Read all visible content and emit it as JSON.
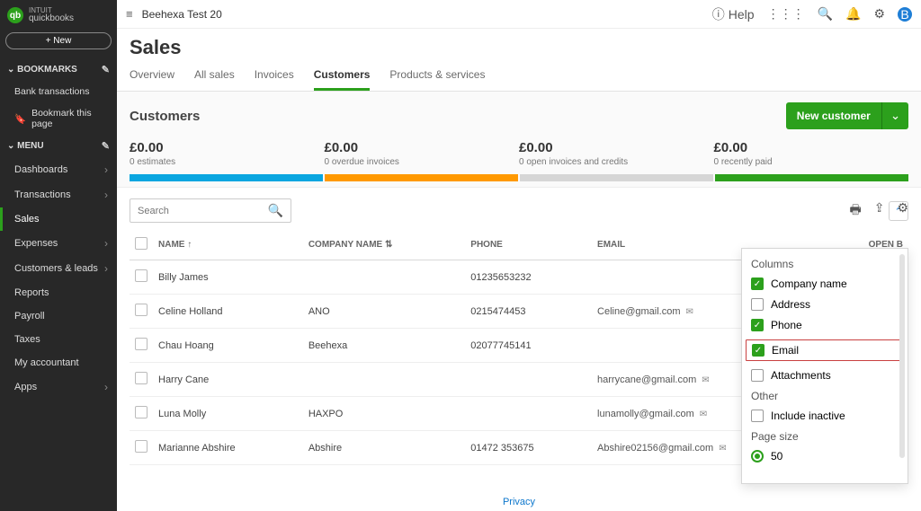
{
  "brand": {
    "short": "qb",
    "name": "quickbooks",
    "sub": "INTUIT"
  },
  "new_btn": "+   New",
  "bookmarks": {
    "title": "BOOKMARKS",
    "items": [
      "Bank transactions",
      "Bookmark this page"
    ]
  },
  "menu": {
    "title": "MENU",
    "items": [
      {
        "label": "Dashboards",
        "arrow": true
      },
      {
        "label": "Transactions",
        "arrow": true
      },
      {
        "label": "Sales",
        "arrow": false,
        "active": true
      },
      {
        "label": "Expenses",
        "arrow": true
      },
      {
        "label": "Customers & leads",
        "arrow": true
      },
      {
        "label": "Reports",
        "arrow": false
      },
      {
        "label": "Payroll",
        "arrow": false
      },
      {
        "label": "Taxes",
        "arrow": false
      },
      {
        "label": "My accountant",
        "arrow": false
      },
      {
        "label": "Apps",
        "arrow": true
      }
    ]
  },
  "topbar": {
    "company": "Beehexa Test 20",
    "help": "Help",
    "avatar": "B"
  },
  "page_title": "Sales",
  "tabs": [
    "Overview",
    "All sales",
    "Invoices",
    "Customers",
    "Products & services"
  ],
  "section_title": "Customers",
  "new_customer": "New customer",
  "stats": [
    {
      "amount": "£0.00",
      "label": "0 estimates"
    },
    {
      "amount": "£0.00",
      "label": "0 overdue invoices"
    },
    {
      "amount": "£0.00",
      "label": "0 open invoices and credits"
    },
    {
      "amount": "£0.00",
      "label": "0 recently paid"
    }
  ],
  "search_placeholder": "Search",
  "columns": {
    "name": "NAME",
    "company": "COMPANY NAME",
    "phone": "PHONE",
    "email": "EMAIL",
    "open": "OPEN B"
  },
  "rows": [
    {
      "name": "Billy James",
      "company": "",
      "phone": "01235653232",
      "email": ""
    },
    {
      "name": "Celine Holland",
      "company": "ANO",
      "phone": "0215474453",
      "email": "Celine@gmail.com"
    },
    {
      "name": "Chau Hoang",
      "company": "Beehexa",
      "phone": "02077745141",
      "email": ""
    },
    {
      "name": "Harry Cane",
      "company": "",
      "phone": "",
      "email": "harrycane@gmail.com"
    },
    {
      "name": "Luna Molly",
      "company": "HAXPO",
      "phone": "",
      "email": "lunamolly@gmail.com"
    },
    {
      "name": "Marianne Abshire",
      "company": "Abshire",
      "phone": "01472 353675",
      "email": "Abshire02156@gmail.com"
    }
  ],
  "settings": {
    "columns_title": "Columns",
    "opts": [
      {
        "label": "Company name",
        "checked": true
      },
      {
        "label": "Address",
        "checked": false
      },
      {
        "label": "Phone",
        "checked": true
      },
      {
        "label": "Email",
        "checked": true,
        "highlight": true
      },
      {
        "label": "Attachments",
        "checked": false
      }
    ],
    "other_title": "Other",
    "include_inactive": "Include inactive",
    "page_size_title": "Page size",
    "page_size_value": "50"
  },
  "privacy": "Privacy"
}
